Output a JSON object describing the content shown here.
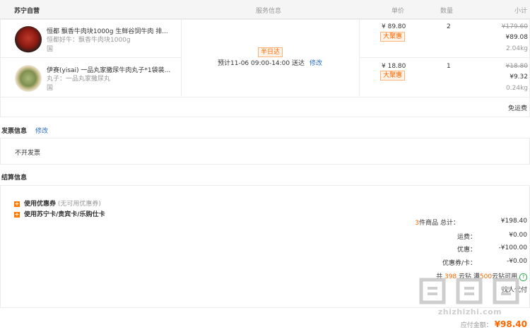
{
  "header": {
    "store": "苏宁自营",
    "col_service": "服务信息",
    "col_price": "单价",
    "col_qty": "数量",
    "col_subtotal": "小计"
  },
  "items": [
    {
      "title": "恒都 飘香牛肉块1000g 生鲜谷饲牛肉 排...",
      "spec": "恒都好牛：飘香牛肉块1000g",
      "extra": "国",
      "price": "¥ 89.80",
      "promo": "大聚惠",
      "qty": "2",
      "orig_total": "¥179.60",
      "total": "¥89.08",
      "weight": "2.04kg"
    },
    {
      "title": "伊赛(yisai) 一品丸家撒尿牛肉丸子*1袋装...",
      "spec": "丸子：一品丸家撒尿丸",
      "extra": "国",
      "price": "¥ 18.80",
      "promo": "大聚惠",
      "qty": "1",
      "orig_total": "¥18.80",
      "total": "¥9.32",
      "weight": "0.24kg"
    }
  ],
  "service": {
    "badge": "半日达",
    "delivery": "预计11-06 09:00-14:00 送达",
    "modify": "修改"
  },
  "shipping": "免运费",
  "invoice": {
    "title": "发票信息",
    "modify": "修改",
    "value": "不开发票"
  },
  "settlement": {
    "title": "结算信息",
    "coupon_label": "使用优惠券",
    "coupon_note": "(无可用优惠券)",
    "card_label": "使用苏宁卡/贵宾卡/乐购仕卡"
  },
  "summary": {
    "count_num": "3",
    "count_label": "件商品 总计：",
    "total": "¥198.40",
    "freight_label": "运费：",
    "freight": "¥0.00",
    "discount_label": "优惠：",
    "discount": "-¥100.00",
    "coupon_label": "优惠券/卡：",
    "coupon": "-¥0.00",
    "points_prefix": "共",
    "points_num": "398",
    "points_mid": "云钻 满",
    "points_num2": "500",
    "points_suffix": "云钻可用",
    "pay_label": "找人代付",
    "payable_label": "应付金额：",
    "payable": "¥98.40"
  },
  "watermark": "zhizhizhi.com"
}
